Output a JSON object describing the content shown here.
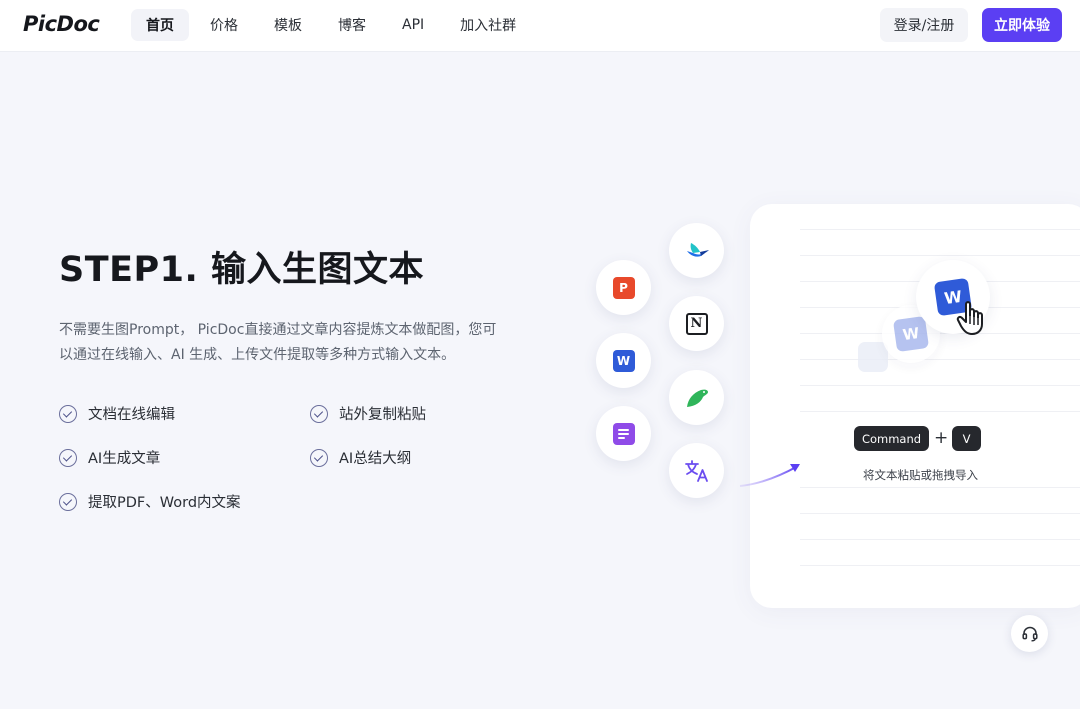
{
  "header": {
    "logo": "PicDoc",
    "nav": [
      {
        "label": "首页",
        "active": true
      },
      {
        "label": "价格",
        "active": false
      },
      {
        "label": "模板",
        "active": false
      },
      {
        "label": "博客",
        "active": false
      },
      {
        "label": "API",
        "active": false
      },
      {
        "label": "加入社群",
        "active": false
      }
    ],
    "login_label": "登录/注册",
    "try_label": "立即体验"
  },
  "hero": {
    "title": "STEP1. 输入生图文本",
    "desc_line1": "不需要生图Prompt， PicDoc直接通过文章内容提炼文本做配图，您可",
    "desc_line2": "以通过在线输入、AI 生成、上传文件提取等多种方式输入文本。",
    "features": [
      "文档在线编辑",
      "站外复制粘贴",
      "AI生成文章",
      "AI总结大纲",
      "提取PDF、Word内文案"
    ]
  },
  "illustration": {
    "word_letter": "W",
    "ppt_letter": "P",
    "notion_letter": "N",
    "key_command": "Command",
    "key_plus": "+",
    "key_v": "V",
    "paste_hint": "将文本粘贴或拖拽导入"
  },
  "colors": {
    "accent": "#5b3ff3",
    "background": "#f5f6fb",
    "ppt_red": "#e8492b",
    "word_blue": "#2f5bd8",
    "onenote_purple": "#8f4be8",
    "bird_green": "#2fb55a"
  },
  "icons": {
    "support": "headset-icon",
    "check": "check-circle-icon",
    "cursor": "hand-pointer-icon"
  }
}
